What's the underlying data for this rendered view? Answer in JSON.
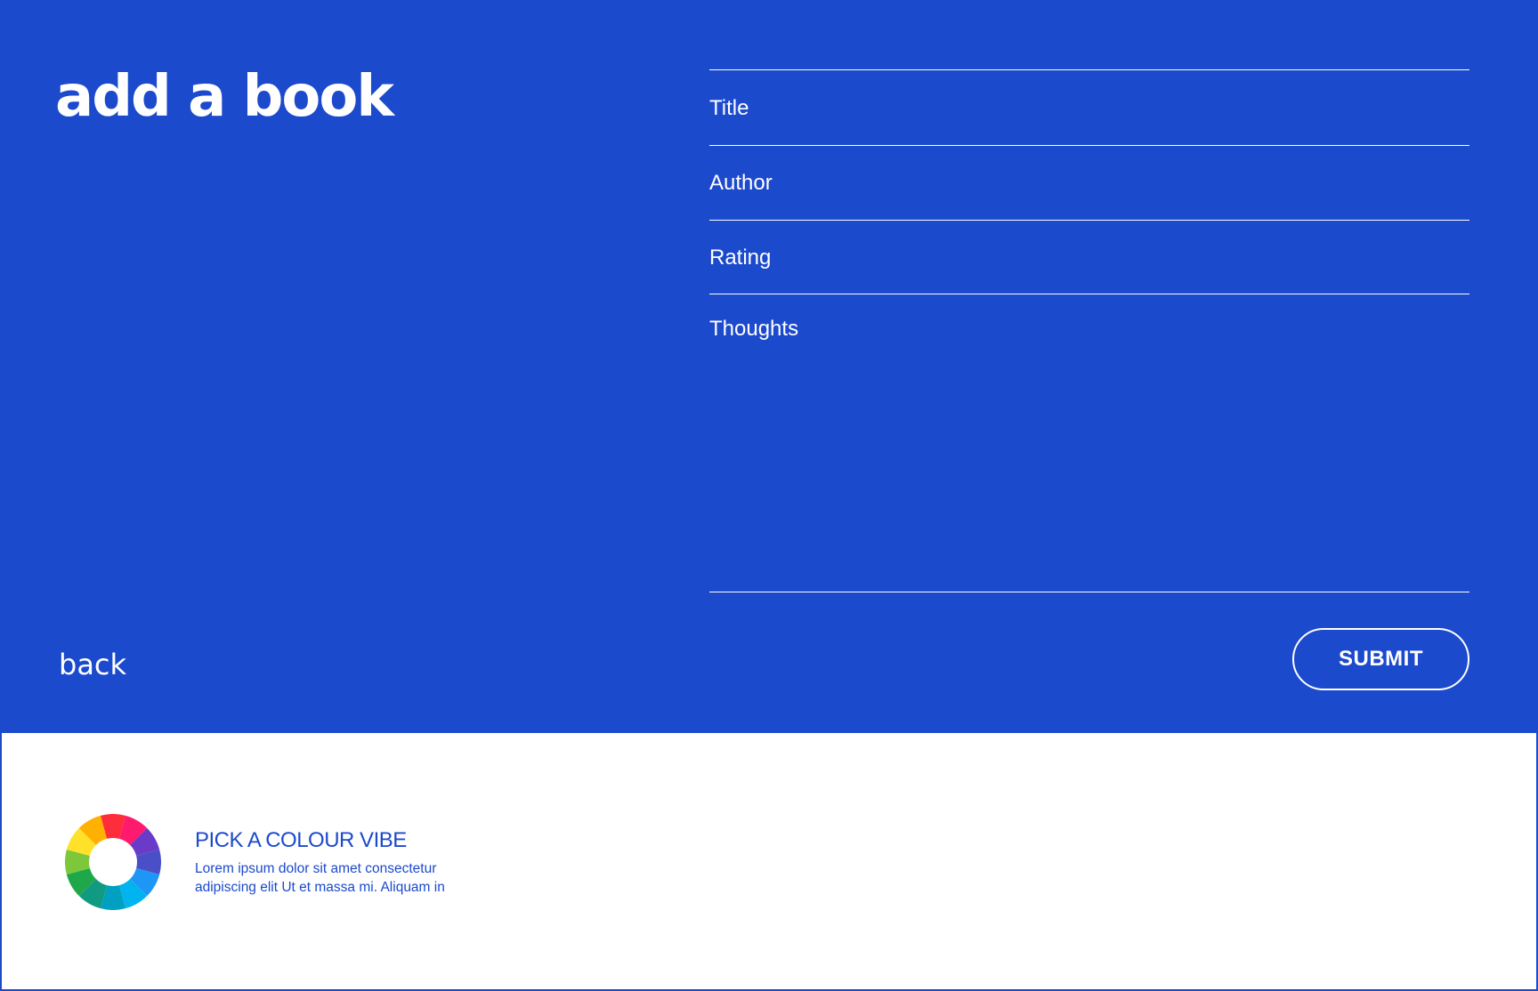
{
  "header": {
    "title": "add a book"
  },
  "form": {
    "title_placeholder": "Title",
    "author_placeholder": "Author",
    "rating_placeholder": "Rating",
    "thoughts_placeholder": "Thoughts",
    "submit_label": "SUBMIT"
  },
  "nav": {
    "back_label": "back"
  },
  "colour_vibe": {
    "heading": "PICK A COLOUR VIBE",
    "description": "Lorem ipsum dolor sit amet consectetur adipiscing elit Ut et massa mi. Aliquam in",
    "wheel_colors": [
      "#ff2d3a",
      "#ff1a6e",
      "#6a3bc8",
      "#4a4fc8",
      "#1e96f5",
      "#00b4f0",
      "#00a0c0",
      "#119a82",
      "#1fa84a",
      "#7cc83a",
      "#ffe12a",
      "#ffb000"
    ]
  },
  "theme": {
    "primary": "#1c4acc",
    "background": "#ffffff",
    "on_primary": "#ffffff"
  }
}
